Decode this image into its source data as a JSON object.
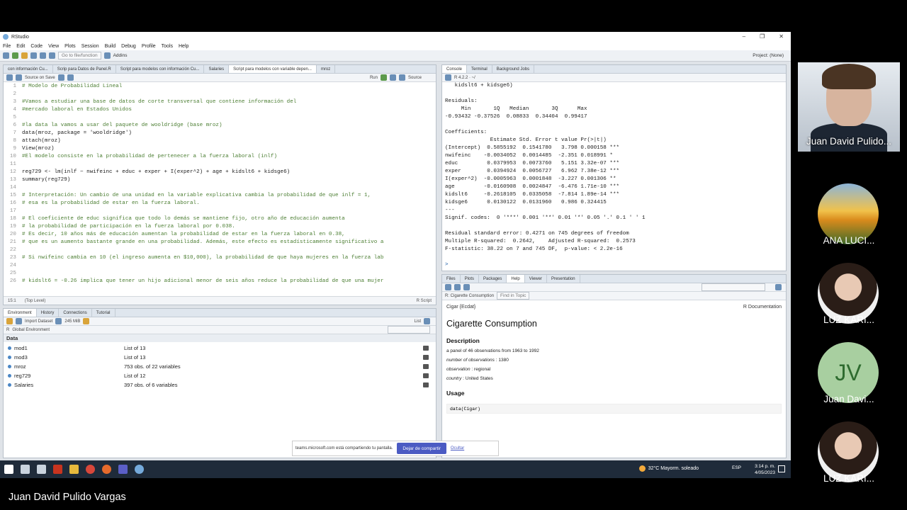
{
  "app": {
    "title": "RStudio",
    "menu": [
      "File",
      "Edit",
      "Code",
      "View",
      "Plots",
      "Session",
      "Build",
      "Debug",
      "Profile",
      "Tools",
      "Help"
    ],
    "goto_placeholder": "Go to file/function",
    "addins_label": "Addins",
    "project_label": "Project: (None)"
  },
  "source": {
    "tabs": [
      "con información Cu...",
      "Scrip para Datos de Panel.R",
      "Script para modelos con información Cu...",
      "Salaries",
      "Script para modelos con variable depen...",
      "mroz"
    ],
    "active_tab": 4,
    "source_on_save": "Source on Save",
    "run_label": "Run",
    "source_label": "Source",
    "lines": [
      {
        "n": "1",
        "text": "# Modelo de Probabilidad Lineal",
        "kind": "comment"
      },
      {
        "n": "2",
        "text": "",
        "kind": "code"
      },
      {
        "n": "3",
        "text": "#Vamos a estudiar una base de datos de corte transversal que contiene información del",
        "kind": "comment"
      },
      {
        "n": "4",
        "text": "#mercado laboral en Estados Unidos",
        "kind": "comment"
      },
      {
        "n": "5",
        "text": "",
        "kind": "code"
      },
      {
        "n": "6",
        "text": "#la data la vamos a usar del paquete de wooldridge (base mroz)",
        "kind": "comment"
      },
      {
        "n": "7",
        "text": "data(mroz, package = 'wooldridge')",
        "kind": "code"
      },
      {
        "n": "8",
        "text": "attach(mroz)",
        "kind": "code"
      },
      {
        "n": "9",
        "text": "View(mroz)",
        "kind": "code"
      },
      {
        "n": "10",
        "text": "#El modelo consiste en la probabilidad de pertenecer a la fuerza laboral (inlf)",
        "kind": "comment"
      },
      {
        "n": "11",
        "text": "",
        "kind": "code"
      },
      {
        "n": "12",
        "text": "reg729 <- lm(inlf ~ nwifeinc + educ + exper + I(exper^2) + age + kidslt6 + kidsge6)",
        "kind": "code"
      },
      {
        "n": "13",
        "text": "summary(reg729)",
        "kind": "code"
      },
      {
        "n": "14",
        "text": "",
        "kind": "code"
      },
      {
        "n": "15",
        "text": "# Interpretación: Un cambio de una unidad en la variable explicativa cambia la probabilidad de que inlf = 1,",
        "kind": "comment"
      },
      {
        "n": "16",
        "text": "# esa es la probabilidad de estar en la fuerza laboral.",
        "kind": "comment"
      },
      {
        "n": "17",
        "text": "",
        "kind": "code"
      },
      {
        "n": "18",
        "text": "# El coeficiente de educ significa que todo lo demás se mantiene fijo, otro año de educación aumenta",
        "kind": "comment"
      },
      {
        "n": "19",
        "text": "# la probabilidad de participación en la fuerza laboral por 0.038.",
        "kind": "comment"
      },
      {
        "n": "20",
        "text": "# Es decir, 10 años más de educación aumentan la probabilidad de estar en la fuerza laboral en 0.38,",
        "kind": "comment"
      },
      {
        "n": "21",
        "text": "# que es un aumento bastante grande en una probabilidad. Además, este efecto es estadísticamente significativo a",
        "kind": "comment"
      },
      {
        "n": "22",
        "text": "",
        "kind": "code"
      },
      {
        "n": "23",
        "text": "# Si nwifeinc cambia en 10 (el ingreso aumenta en $10,000), la probabilidad de que haya mujeres en la fuerza lab",
        "kind": "comment"
      },
      {
        "n": "24",
        "text": "",
        "kind": "code"
      },
      {
        "n": "25",
        "text": "",
        "kind": "code"
      },
      {
        "n": "26",
        "text": "# kidslt6 = -0.26 implica que tener un hijo adicional menor de seis años reduce la probabilidad de que una mujer",
        "kind": "comment"
      }
    ],
    "cursor_pos": "15:1",
    "scope": "(Top Level)",
    "filetype": "R Script"
  },
  "console": {
    "tabs": [
      "Console",
      "Terminal",
      "Background Jobs"
    ],
    "version": "R 4.2.2 · ~/",
    "lines": [
      "   kidslt6 + kidsge6)",
      "",
      "Residuals:",
      "     Min       1Q   Median       3Q      Max ",
      "-0.93432 -0.37526  0.08833  0.34404  0.99417 ",
      "",
      "Coefficients:",
      "              Estimate Std. Error t value Pr(>|t|)    ",
      "(Intercept)  0.5855192  0.1541780   3.798 0.000158 ***",
      "nwifeinc    -0.0034052  0.0014485  -2.351 0.018991 *  ",
      "educ         0.0379953  0.0073760   5.151 3.32e-07 ***",
      "exper        0.0394924  0.0056727   6.962 7.38e-12 ***",
      "I(exper^2)  -0.0005963  0.0001848  -3.227 0.001306 ** ",
      "age         -0.0160908  0.0024847  -6.476 1.71e-10 ***",
      "kidslt6     -0.2618105  0.0335058  -7.814 1.89e-14 ***",
      "kidsge6      0.0130122  0.0131960   0.986 0.324415    ",
      "---",
      "Signif. codes:  0 '***' 0.001 '**' 0.01 '*' 0.05 '.' 0.1 ' ' 1",
      "",
      "Residual standard error: 0.4271 on 745 degrees of freedom",
      "Multiple R-squared:  0.2642,    Adjusted R-squared:  0.2573 ",
      "F-statistic: 38.22 on 7 and 745 DF,  p-value: < 2.2e-16",
      "",
      ">"
    ]
  },
  "environment": {
    "tabs": [
      "Environment",
      "History",
      "Connections",
      "Tutorial"
    ],
    "import_label": "Import Dataset",
    "memory": "245 MiB",
    "view_mode": "List",
    "scope": "Global Environment",
    "section": "Data",
    "rows": [
      {
        "name": "mod1",
        "value": "List of  13"
      },
      {
        "name": "mod3",
        "value": "List of  13"
      },
      {
        "name": "mroz",
        "value": "753 obs. of 22 variables"
      },
      {
        "name": "reg729",
        "value": "List of  12"
      },
      {
        "name": "Salaries",
        "value": "397 obs. of 6 variables"
      }
    ]
  },
  "help": {
    "tabs": [
      "Files",
      "Plots",
      "Packages",
      "Help",
      "Viewer",
      "Presentation"
    ],
    "topic": "R: Cigarette Consumption",
    "find_placeholder": "Find in Topic",
    "pkg": "Cigar {Ecdat}",
    "rdoc": "R Documentation",
    "title": "Cigarette Consumption",
    "desc_heading": "Description",
    "desc": "a panel of 46 observations from 1963 to 1992",
    "nobs_label": "number of observations",
    "nobs_value": ": 1380",
    "obs_label": "observation",
    "obs_value": ": regional",
    "country_label": "country",
    "country_value": ": United States",
    "usage_heading": "Usage",
    "usage_code": "data(Cigar)"
  },
  "share": {
    "message": "teams.microsoft.com está compartiendo tu pantalla.",
    "stop": "Dejar de compartir",
    "hide": "Ocultar"
  },
  "taskbar": {
    "weather": "32°C  Mayorm. soleado",
    "lang": "ESP",
    "time": "3:14 p. m.",
    "date": "4/05/2023"
  },
  "meeting": {
    "presenter": "Juan David Pulido Vargas",
    "participants": [
      {
        "name": "Juan David Pulido...",
        "kind": "video"
      },
      {
        "name": "ANA LUCI...",
        "kind": "photo-sunflower"
      },
      {
        "name": "LUZ KARI...",
        "kind": "photo-girl"
      },
      {
        "name": "Juan Davi...",
        "kind": "initials",
        "initials": "JV"
      },
      {
        "name": "LUZ KARI...",
        "kind": "photo-girl"
      }
    ]
  }
}
